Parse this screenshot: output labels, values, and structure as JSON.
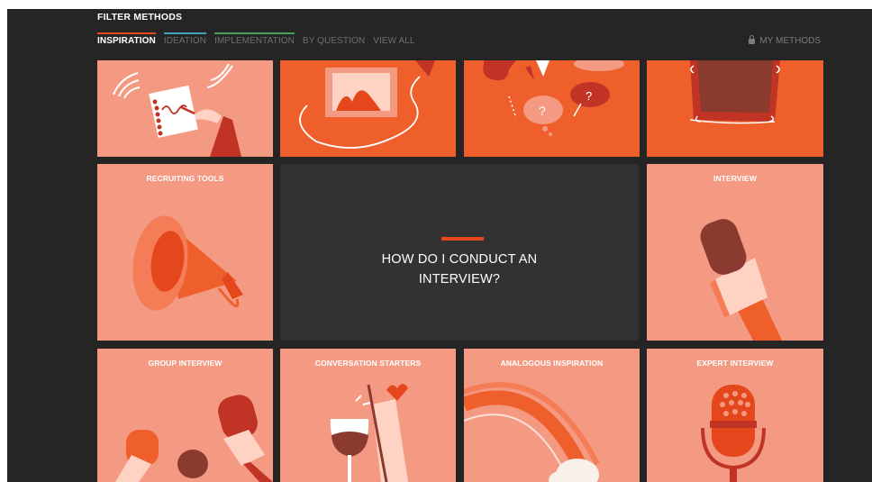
{
  "filter": {
    "title": "FILTER METHODS",
    "tabs": [
      {
        "label": "INSPIRATION",
        "underline": "#e4471c",
        "active": true
      },
      {
        "label": "IDEATION",
        "underline": "#3fa2b6",
        "active": false
      },
      {
        "label": "IMPLEMENTATION",
        "underline": "#4aa05a",
        "active": false
      },
      {
        "label": "BY QUESTION",
        "underline": "",
        "active": false
      },
      {
        "label": "VIEW ALL",
        "underline": "",
        "active": false
      }
    ],
    "my_methods": "MY METHODS"
  },
  "question": {
    "text": "HOW DO I CONDUCT AN INTERVIEW?"
  },
  "tiles": [
    {
      "label": "",
      "icon": "notebook-pen-icon"
    },
    {
      "label": "",
      "icon": "photo-frame-icon"
    },
    {
      "label": "",
      "icon": "speech-bubbles-icon"
    },
    {
      "label": "",
      "icon": "picture-frame-icon"
    },
    {
      "label": "RECRUITING TOOLS",
      "icon": "megaphone-icon"
    },
    {
      "label": "INTERVIEW",
      "icon": "microphone-icon"
    },
    {
      "label": "GROUP INTERVIEW",
      "icon": "microphones-icon"
    },
    {
      "label": "CONVERSATION STARTERS",
      "icon": "wine-glasses-icon"
    },
    {
      "label": "ANALOGOUS INSPIRATION",
      "icon": "rainbow-icon"
    },
    {
      "label": "EXPERT INTERVIEW",
      "icon": "studio-microphone-icon"
    }
  ],
  "colors": {
    "background": "#252525",
    "salmon": "#f59a82",
    "orange": "#ef5f2c",
    "dark_red": "#c03325",
    "question_bg": "#323232"
  }
}
